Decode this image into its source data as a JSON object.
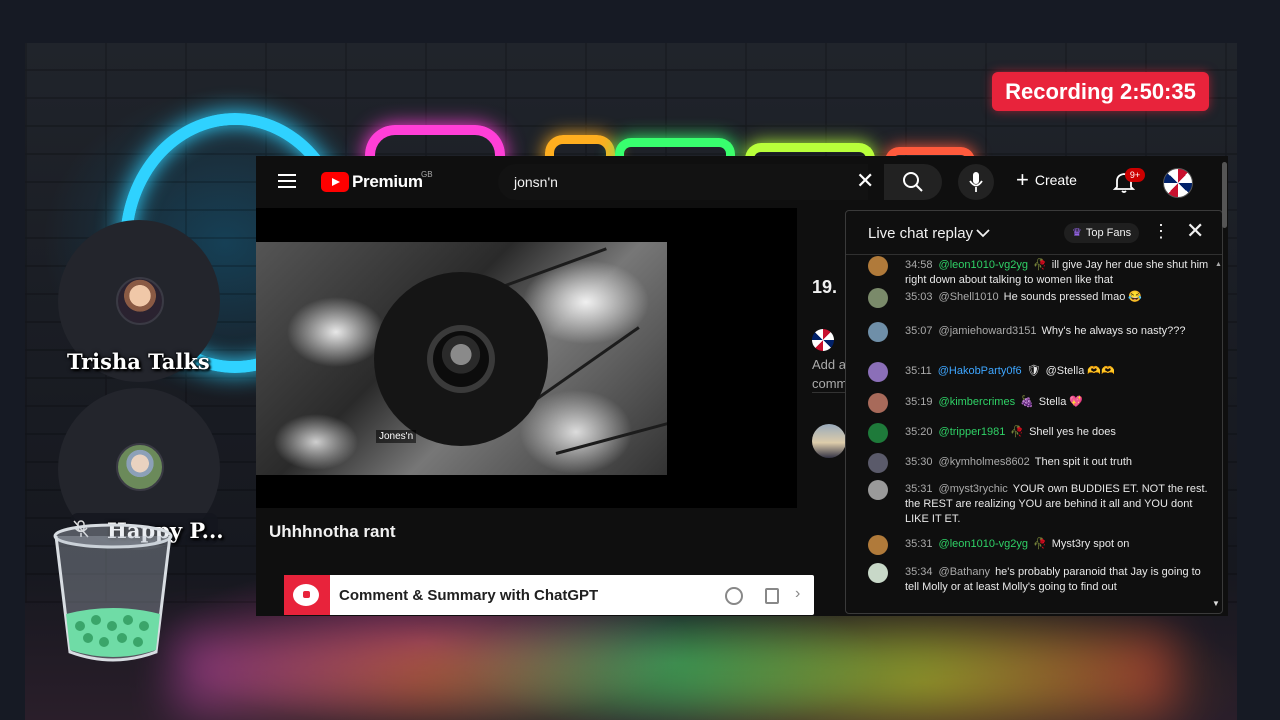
{
  "recording": {
    "label": "Recording 2:50:35"
  },
  "participants": [
    {
      "name": "Trisha Talks"
    },
    {
      "name": "Happy P..."
    }
  ],
  "youtube": {
    "brand": "Premium",
    "region": "GB",
    "search_value": "jonsn'n",
    "create_label": "Create",
    "notification_count": "9+"
  },
  "video": {
    "speaker_label": "Jones'n",
    "title": "Uhhhnotha rant"
  },
  "side": {
    "views": "19.",
    "add_comment": [
      "Add a",
      "comm"
    ]
  },
  "chatgpt_bar": {
    "label": "Comment & Summary with ChatGPT"
  },
  "chat": {
    "title": "Live chat replay",
    "top_fans": "Top Fans",
    "messages": [
      {
        "time": "34:58",
        "author": "@leon1010-vg2yg",
        "author_color": "green",
        "badge": "🥀",
        "text": "ill give Jay her due she shut him right down about talking to women like that"
      },
      {
        "time": "35:03",
        "author": "@Shell1010",
        "author_color": "gray",
        "badge": "",
        "text": "He sounds pressed lmao 😂"
      },
      {
        "time": "35:07",
        "author": "@jamiehoward3151",
        "author_color": "gray",
        "badge": "",
        "text": "Why's he always so nasty???"
      },
      {
        "time": "35:11",
        "author": "@HakobParty0f6",
        "author_color": "blue",
        "badge": "🛡",
        "text": "@Stella 🫶🫶"
      },
      {
        "time": "35:19",
        "author": "@kimbercrimes",
        "author_color": "green",
        "badge": "🍇",
        "text": "Stella 💖"
      },
      {
        "time": "35:20",
        "author": "@tripper1981",
        "author_color": "green",
        "badge": "🥀",
        "text": "Shell yes he does"
      },
      {
        "time": "35:30",
        "author": "@kymholmes8602",
        "author_color": "gray",
        "badge": "",
        "text": "Then spit it out truth"
      },
      {
        "time": "35:31",
        "author": "@myst3rychic",
        "author_color": "gray",
        "badge": "",
        "text": "YOUR own BUDDIES ET. NOT the rest. the REST are realizing YOU are behind it all and YOU dont LIKE IT ET."
      },
      {
        "time": "35:31",
        "author": "@leon1010-vg2yg",
        "author_color": "green",
        "badge": "🥀",
        "text": "Myst3ry spot on"
      },
      {
        "time": "35:34",
        "author": "@Bathany",
        "author_color": "gray",
        "badge": "",
        "text": "he's probably paranoid that Jay is going to tell Molly or at least Molly's going to find out"
      }
    ]
  },
  "colors": {
    "accent_red": "#e8233b",
    "youtube_red": "#ff0000",
    "chat_green": "#2fd166",
    "chat_blue": "#3ea6ff",
    "page_bg": "#0f0f0f"
  },
  "icons": [
    "hamburger-icon",
    "youtube-logo-icon",
    "clear-search-icon",
    "search-icon",
    "mic-icon",
    "plus-icon",
    "bell-icon",
    "crown-icon",
    "kebab-menu-icon",
    "close-icon",
    "chatgpt-icon",
    "openai-icon",
    "copy-icon",
    "chevron-right-icon",
    "muted-mic-icon",
    "trash-cup-icon"
  ]
}
